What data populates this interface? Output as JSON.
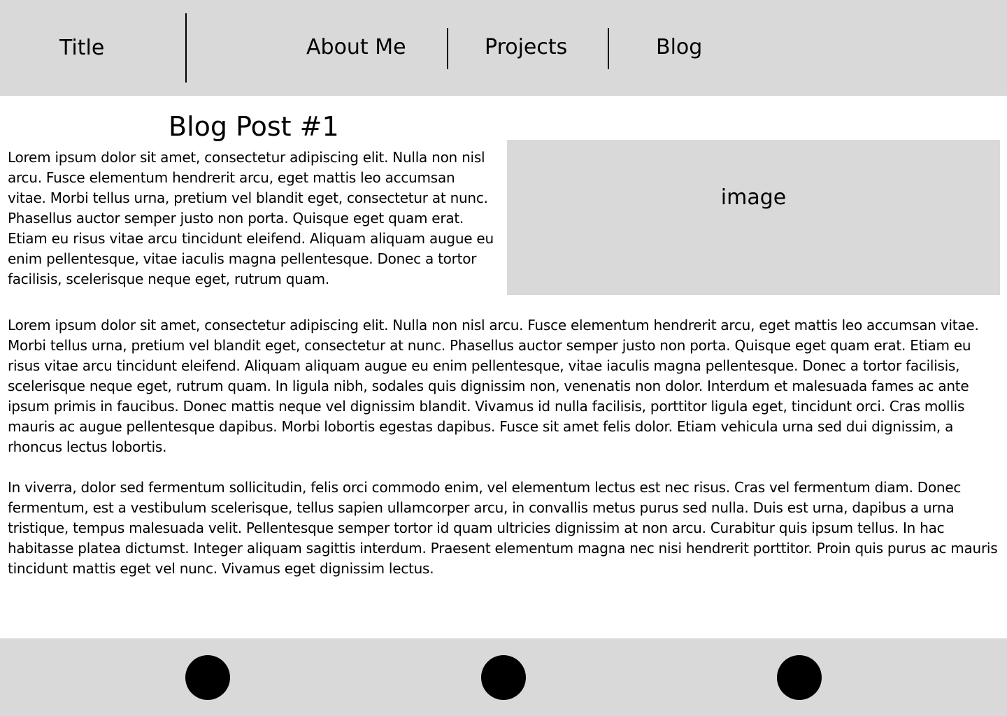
{
  "header": {
    "title": "Title",
    "nav": {
      "about": "About Me",
      "projects": "Projects",
      "blog": "Blog"
    }
  },
  "post": {
    "title": "Blog Post #1",
    "intro": "Lorem ipsum dolor sit amet, consectetur adipiscing elit. Nulla non nisl  arcu. Fusce elementum hendrerit arcu, eget mattis leo accumsan vitae.  Morbi tellus urna, pretium vel blandit eget, consectetur at nunc.  Phasellus auctor semper justo non porta. Quisque eget quam erat. Etiam  eu risus vitae arcu tincidunt eleifend. Aliquam aliquam augue eu enim pellentesque, vitae iaculis magna  pellentesque. Donec a tortor facilisis, scelerisque neque eget, rutrum  quam.",
    "image_label": "image",
    "paragraph_1": " Lorem ipsum dolor sit amet, consectetur adipiscing elit. Nulla non nisl  arcu. Fusce elementum hendrerit arcu, eget mattis leo accumsan vitae.  Morbi tellus urna, pretium vel blandit eget, consectetur at nunc.  Phasellus auctor semper justo non porta. Quisque eget quam erat. Etiam  eu risus vitae arcu tincidunt eleifend. Aliquam aliquam augue eu enim  pellentesque, vitae iaculis magna pellentesque. Donec a tortor  facilisis, scelerisque neque eget, rutrum quam. In ligula nibh, sodales  quis dignissim non, venenatis non dolor. Interdum et malesuada fames ac  ante ipsum primis in faucibus. Donec mattis neque vel dignissim blandit.  Vivamus id nulla facilisis, porttitor ligula eget, tincidunt orci. Cras  mollis mauris ac augue pellentesque dapibus. Morbi lobortis egestas  dapibus. Fusce sit amet felis dolor. Etiam vehicula urna sed dui  dignissim, a rhoncus lectus lobortis.",
    "paragraph_2": " In viverra, dolor sed fermentum sollicitudin, felis orci commodo enim,  vel elementum lectus est nec risus. Cras vel fermentum diam. Donec  fermentum, est a vestibulum scelerisque, tellus sapien ullamcorper arcu,  in convallis metus purus sed nulla. Duis est urna, dapibus a urna  tristique, tempus malesuada velit. Pellentesque semper tortor id quam  ultricies dignissim at non arcu. Curabitur quis ipsum tellus. In hac  habitasse platea dictumst. Integer aliquam sagittis interdum. Praesent  elementum magna nec nisi hendrerit porttitor. Proin quis purus ac mauris  tincidunt mattis eget vel nunc. Vivamus eget dignissim lectus."
  },
  "colors": {
    "header_bg": "#d9d9d9",
    "footer_bg": "#d9d9d9",
    "image_bg": "#d9d9d9",
    "text": "#000000",
    "circle": "#000000"
  },
  "footer": {
    "icons": [
      "circle-icon",
      "circle-icon",
      "circle-icon"
    ]
  }
}
